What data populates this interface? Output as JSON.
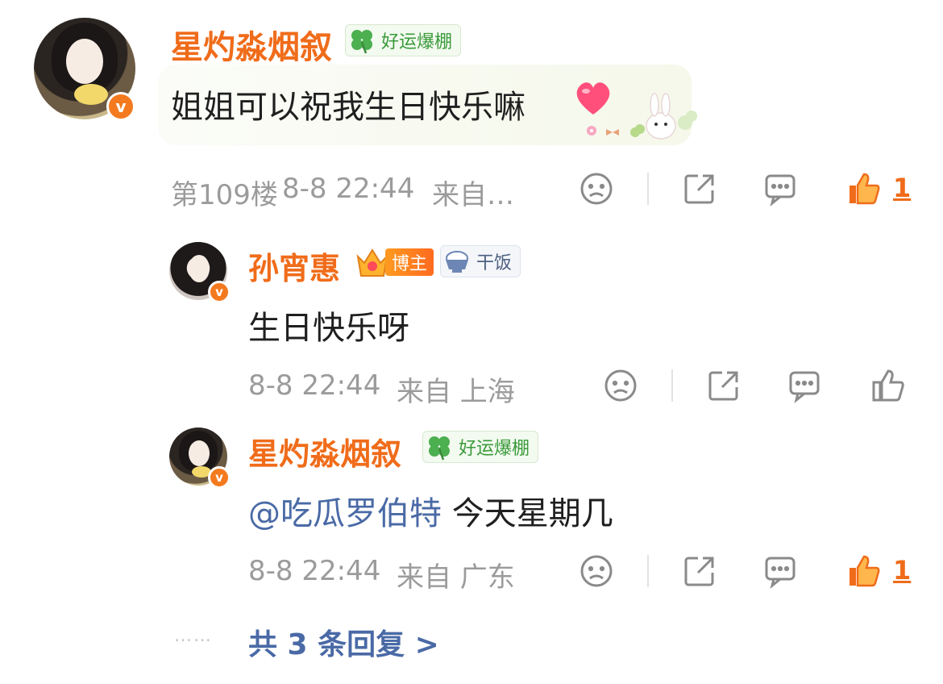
{
  "comment": {
    "username": "星灼淼烟叙",
    "tag": "好运爆棚",
    "text": "姐姐可以祝我生日快乐嘛",
    "floor": "第109楼",
    "datetime": "8-8 22:44",
    "source": "来自…",
    "likes": "1"
  },
  "replies": [
    {
      "username": "孙宵惠",
      "blogger_badge": "博主",
      "tag": "干饭",
      "text": "生日快乐呀",
      "datetime": "8-8 22:44",
      "source": "来自 上海"
    },
    {
      "username": "星灼淼烟叙",
      "tag": "好运爆棚",
      "mention": "@吃瓜罗伯特",
      "text": "今天星期几",
      "datetime": "8-8 22:44",
      "source": "来自 广东",
      "likes": "1"
    }
  ],
  "more": {
    "dots": "……",
    "label": "共 3 条回复 >"
  },
  "colors": {
    "username": "#f06c1a",
    "meta": "#9b9b9b",
    "link": "#4a6aa6",
    "tag_green": "#3a9a3a"
  }
}
